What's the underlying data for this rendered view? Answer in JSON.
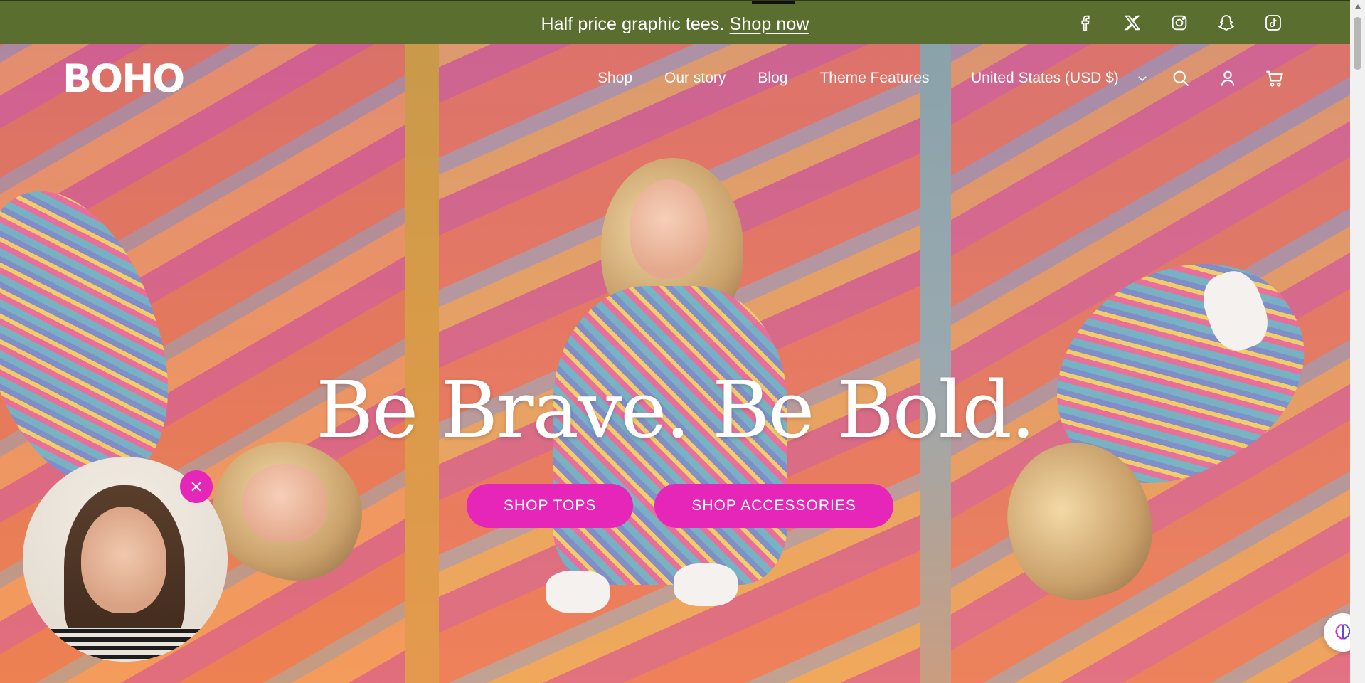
{
  "announcement": {
    "text": "Half price graphic tees.",
    "link": "Shop now"
  },
  "socials": [
    {
      "name": "facebook-icon"
    },
    {
      "name": "x-icon"
    },
    {
      "name": "instagram-icon"
    },
    {
      "name": "snapchat-icon"
    },
    {
      "name": "tiktok-icon"
    }
  ],
  "header": {
    "logo": "BOHO",
    "nav": [
      "Shop",
      "Our story",
      "Blog",
      "Theme Features"
    ],
    "currency": "United States (USD $)"
  },
  "hero": {
    "headline": "Be Brave. Be Bold.",
    "cta_primary": "SHOP TOPS",
    "cta_secondary": "SHOP ACCESSORIES"
  },
  "colors": {
    "announcement_bg": "#5a6e30",
    "accent": "#e626b8",
    "text_light": "#ffffff"
  }
}
